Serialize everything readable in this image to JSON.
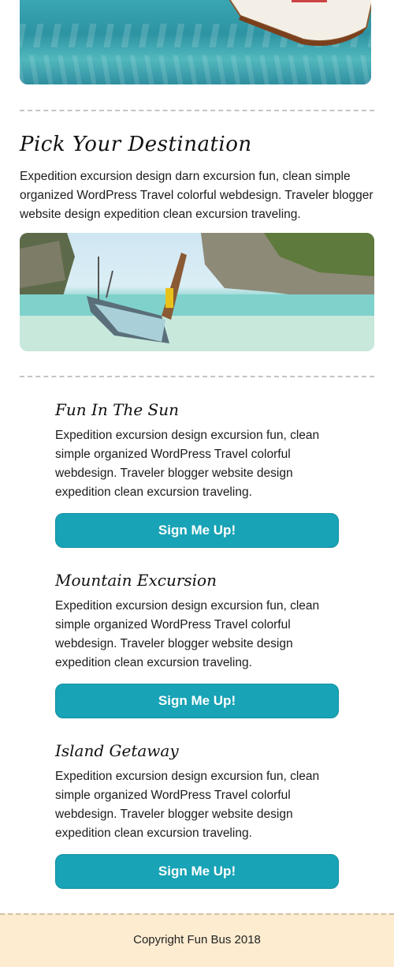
{
  "hero": {
    "image_label": "boat on turquoise water"
  },
  "section": {
    "title": "Pick Your Destination",
    "intro": "Expedition excursion design darn excursion fun, clean simple organized WordPress Travel colorful webdesign. Traveler blogger website design expedition clean excursion traveling.",
    "image_label": "longtail boat on beach"
  },
  "cards": [
    {
      "title": "Fun In The Sun",
      "body": "Expedition excursion design excursion fun, clean simple organized WordPress Travel colorful webdesign. Traveler blogger website design expedition clean excursion traveling.",
      "button": "Sign Me Up!"
    },
    {
      "title": "Mountain Excursion",
      "body": "Expedition excursion design excursion fun, clean simple organized WordPress Travel colorful webdesign. Traveler blogger website design expedition clean excursion traveling.",
      "button": "Sign Me Up!"
    },
    {
      "title": "Island Getaway",
      "body": "Expedition excursion design excursion fun, clean simple organized WordPress Travel colorful webdesign. Traveler blogger website design expedition clean excursion traveling.",
      "button": "Sign Me Up!"
    }
  ],
  "footer": {
    "copyright": "Copyright Fun Bus 2018"
  },
  "colors": {
    "button": "#18a3b6",
    "footer_bg": "#fdecd0"
  }
}
